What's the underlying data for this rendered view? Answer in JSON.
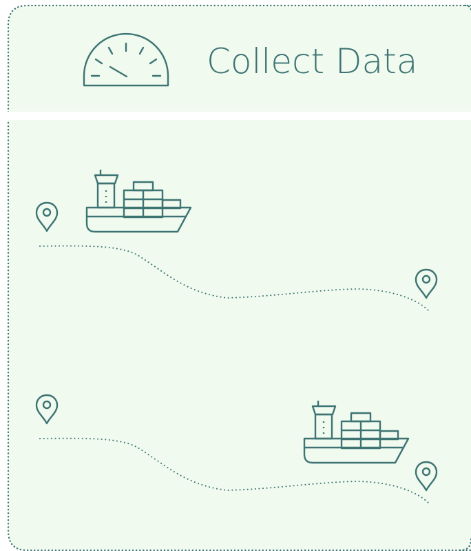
{
  "header": {
    "title": "Collect Data",
    "icon": "speedometer-icon"
  },
  "routes": [
    {
      "name": "route-1",
      "ship_icon": "cargo-ship-icon",
      "origin_icon": "map-pin-icon",
      "destination_icon": "map-pin-icon"
    },
    {
      "name": "route-2",
      "ship_icon": "cargo-ship-icon",
      "origin_icon": "map-pin-icon",
      "destination_icon": "map-pin-icon"
    }
  ],
  "colors": {
    "background": "#f0faef",
    "stroke": "#3d7473",
    "divider": "#ffffff"
  }
}
